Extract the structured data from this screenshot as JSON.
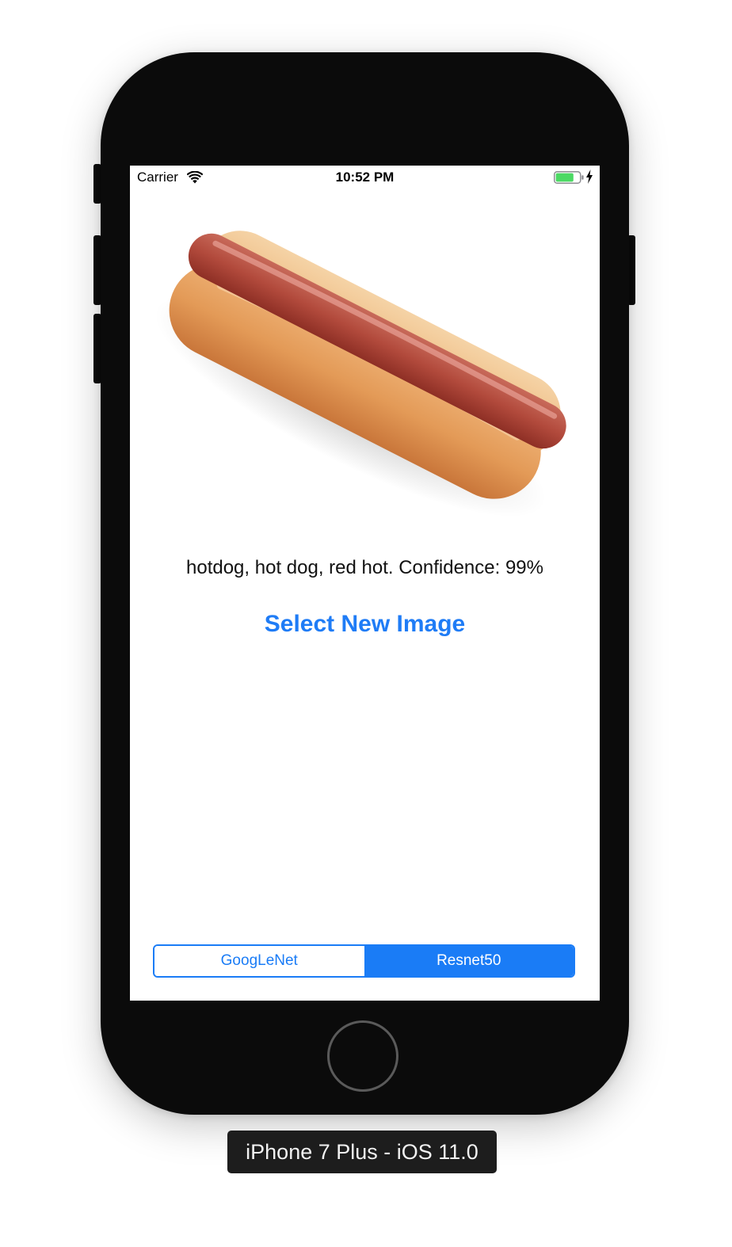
{
  "status_bar": {
    "carrier": "Carrier",
    "time": "10:52 PM",
    "wifi_icon": "wifi-icon",
    "battery_icon": "battery-charging-icon",
    "battery_fill_fraction": 0.75,
    "battery_color": "#4cd964"
  },
  "main": {
    "image_icon": "hotdog-photo",
    "result_text": "hotdog, hot dog, red hot. Confidence: 99%",
    "select_button_label": "Select New Image",
    "accent_color": "#1a7cf6"
  },
  "model_selector": {
    "segments": [
      {
        "label": "GoogLeNet",
        "selected": false
      },
      {
        "label": "Resnet50",
        "selected": true
      }
    ]
  },
  "simulator": {
    "device_label": "iPhone 7 Plus - iOS 11.0"
  }
}
